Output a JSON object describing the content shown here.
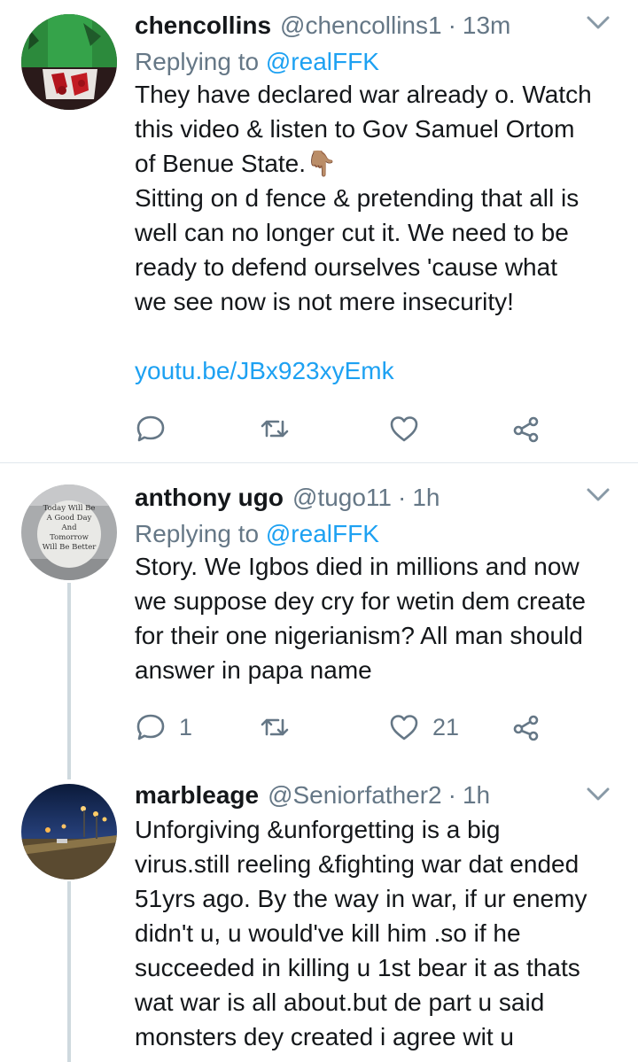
{
  "tweets": [
    {
      "display_name": "chencollins",
      "handle": "@chencollins1",
      "time": "13m",
      "replying_label": "Replying to",
      "replying_to": "@realFFK",
      "text": "They have declared war already o. Watch\nthis video & listen to Gov Samuel Ortom\nof Benue State.👇🏽\nSitting on d fence & pretending that all is\nwell can no longer cut it. We need to be\nready to defend ourselves 'cause what\nwe see now is not mere insecurity!",
      "link": "youtu.be/JBx923xyEmk",
      "reply_count": "",
      "like_count": ""
    },
    {
      "display_name": "anthony ugo",
      "handle": "@tugo11",
      "time": "1h",
      "replying_label": "Replying to",
      "replying_to": "@realFFK",
      "text": "Story. We Igbos died in millions and now\nwe suppose dey cry for wetin dem create\nfor their one nigerianism? All man should\nanswer in papa name",
      "avatar_text": [
        "Today Will Be",
        "A Good Day",
        "And",
        "Tomorrow",
        "Will Be Better"
      ],
      "reply_count": "1",
      "like_count": "21"
    },
    {
      "display_name": "marbleage",
      "handle": "@Seniorfather2",
      "time": "1h",
      "text": "Unforgiving &unforgetting is a big\nvirus.still reeling &fighting war dat ended\n51yrs ago. By the way in war, if ur enemy\ndidn't u, u would've kill him .so if he\nsucceeded in killing u 1st bear it as thats\nwat war is all about.but de part u said\nmonsters dey created i agree wit u"
    }
  ],
  "separator": "·",
  "colors": {
    "text": "#14171a",
    "secondary": "#657786",
    "link": "#1da1f2",
    "divider": "#e1e8ed",
    "thread_line": "#cfd9de"
  },
  "icons": [
    "reply-icon",
    "retweet-icon",
    "like-icon",
    "share-icon",
    "chevron-down-icon"
  ]
}
